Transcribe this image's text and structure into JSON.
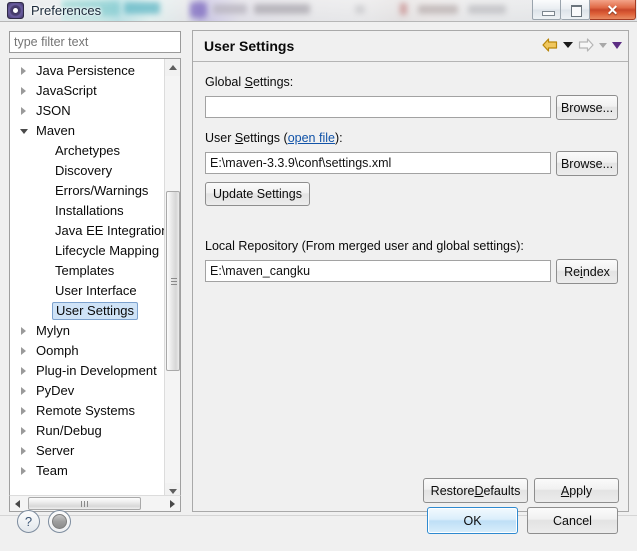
{
  "window": {
    "title": "Preferences",
    "app_icon": "gear-icon",
    "controls": {
      "minimize": "minimize-icon",
      "maximize": "maximize-icon",
      "close": "✕"
    }
  },
  "sidebar": {
    "filter": {
      "value": "",
      "placeholder": "type filter text"
    },
    "tree": [
      {
        "label": "Java Persistence",
        "level": 0,
        "state": "collapsed",
        "selected": false
      },
      {
        "label": "JavaScript",
        "level": 0,
        "state": "collapsed",
        "selected": false
      },
      {
        "label": "JSON",
        "level": 0,
        "state": "collapsed",
        "selected": false
      },
      {
        "label": "Maven",
        "level": 0,
        "state": "expanded",
        "selected": false
      },
      {
        "label": "Archetypes",
        "level": 1,
        "state": "leaf",
        "selected": false
      },
      {
        "label": "Discovery",
        "level": 1,
        "state": "leaf",
        "selected": false
      },
      {
        "label": "Errors/Warnings",
        "level": 1,
        "state": "leaf",
        "selected": false
      },
      {
        "label": "Installations",
        "level": 1,
        "state": "leaf",
        "selected": false
      },
      {
        "label": "Java EE Integration",
        "level": 1,
        "state": "leaf",
        "selected": false
      },
      {
        "label": "Lifecycle Mapping",
        "level": 1,
        "state": "leaf",
        "selected": false
      },
      {
        "label": "Templates",
        "level": 1,
        "state": "leaf",
        "selected": false
      },
      {
        "label": "User Interface",
        "level": 1,
        "state": "leaf",
        "selected": false
      },
      {
        "label": "User Settings",
        "level": 1,
        "state": "leaf",
        "selected": true
      },
      {
        "label": "Mylyn",
        "level": 0,
        "state": "collapsed",
        "selected": false
      },
      {
        "label": "Oomph",
        "level": 0,
        "state": "collapsed",
        "selected": false
      },
      {
        "label": "Plug-in Development",
        "level": 0,
        "state": "collapsed",
        "selected": false
      },
      {
        "label": "PyDev",
        "level": 0,
        "state": "collapsed",
        "selected": false
      },
      {
        "label": "Remote Systems",
        "level": 0,
        "state": "collapsed",
        "selected": false
      },
      {
        "label": "Run/Debug",
        "level": 0,
        "state": "collapsed",
        "selected": false
      },
      {
        "label": "Server",
        "level": 0,
        "state": "collapsed",
        "selected": false
      },
      {
        "label": "Team",
        "level": 0,
        "state": "collapsed",
        "selected": false
      }
    ]
  },
  "page": {
    "title": "User Settings",
    "nav": {
      "back": "back-arrow-icon",
      "back_menu": "chevron-down-icon",
      "forward": "forward-arrow-icon",
      "forward_menu": "chevron-down-icon",
      "view_menu": "chevron-down-icon"
    },
    "global_settings": {
      "label_pre": "Global ",
      "label_accel": "S",
      "label_post": "ettings:",
      "value": "",
      "browse_label": "Browse..."
    },
    "user_settings": {
      "label_pre": "User ",
      "label_accel": "S",
      "label_mid": "ettings (",
      "link": "open file",
      "label_post": "):",
      "value": "E:\\maven-3.3.9\\conf\\settings.xml",
      "browse_label": "Browse...",
      "update_label": "Update Settings"
    },
    "local_repository": {
      "label": "Local Repository (From merged user and global settings):",
      "value": "E:\\maven_cangku",
      "reindex_pre": "Re",
      "reindex_accel": "i",
      "reindex_post": "ndex"
    },
    "restore_defaults": {
      "pre": "Restore ",
      "accel": "D",
      "post": "efaults"
    },
    "apply": {
      "accel": "A",
      "post": "pply"
    }
  },
  "footer": {
    "help_icon": "?",
    "extra_icon": "circle-button-icon",
    "ok_label": "OK",
    "cancel_label": "Cancel"
  },
  "colors": {
    "selection_bg": "#cfe3f7",
    "selection_border": "#7da2ce",
    "link": "#1153a8",
    "back_arrow": "#d9a31c",
    "forward_arrow": "#b5b5b5",
    "view_menu_arrow": "#5c2d83",
    "close_button": "#c9472a",
    "default_button_border": "#2e8ad0"
  }
}
